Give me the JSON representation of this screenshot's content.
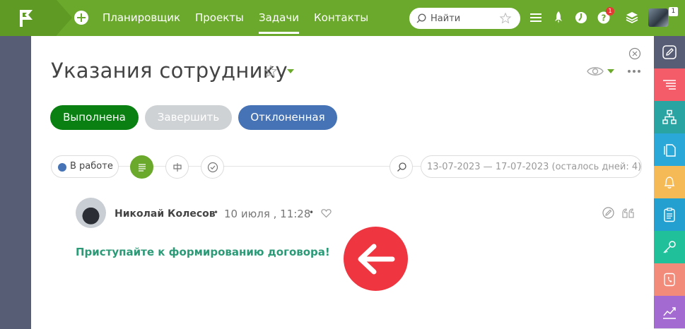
{
  "nav": {
    "items": [
      {
        "label": "Планировщик",
        "active": false
      },
      {
        "label": "Проекты",
        "active": false
      },
      {
        "label": "Задачи",
        "active": true
      },
      {
        "label": "Контакты",
        "active": false
      }
    ],
    "search_placeholder": "Найти",
    "notification_count": "1",
    "user_badge": "1"
  },
  "task": {
    "title": "Указания сотруднику",
    "buttons": {
      "done": "Выполнена",
      "finish": "Завершить",
      "reject": "Отклоненная"
    },
    "status": "В работе",
    "date_range": "13-07-2023 — 17-07-2023",
    "days_left": "(осталось дней: 4)"
  },
  "comment": {
    "author": "Николай Колесов",
    "separator": "•",
    "date": "10 июля , 11:28",
    "text": "Приступайте к формированию договора!"
  },
  "colors": {
    "brand_green": "#6aa92b",
    "done_green": "#0a7f12",
    "reject_blue": "#4673b5",
    "arrow_red": "#ee3540",
    "comment_teal": "#2c9a77"
  },
  "right_sidebar": [
    {
      "icon": "edit-icon",
      "color": "#575d74"
    },
    {
      "icon": "list-icon",
      "color": "#f45c6a"
    },
    {
      "icon": "hierarchy-icon",
      "color": "#2aa3a3"
    },
    {
      "icon": "documents-icon",
      "color": "#2aa9d8"
    },
    {
      "icon": "bell-icon",
      "color": "#f5b955"
    },
    {
      "icon": "clipboard-icon",
      "color": "#23a0cf"
    },
    {
      "icon": "key-icon",
      "color": "#20c19a"
    },
    {
      "icon": "phone-book-icon",
      "color": "#f28b7a"
    },
    {
      "icon": "chart-icon",
      "color": "#a36ad1"
    }
  ]
}
